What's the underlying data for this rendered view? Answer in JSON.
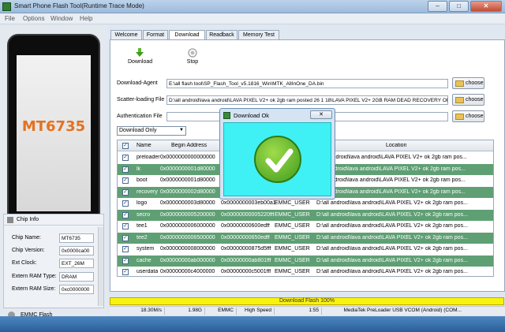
{
  "window": {
    "title": "Smart Phone Flash Tool(Runtime Trace Mode)",
    "buttons": {
      "minimize": "–",
      "maximize": "□",
      "close": "✕"
    }
  },
  "menu": [
    "File",
    "Options",
    "Window",
    "Help"
  ],
  "left_panel": {
    "chip_label": "MT6735",
    "chip_info_title": "Chip Info",
    "fields": [
      {
        "label": "Chip Name:",
        "value": "MT6735"
      },
      {
        "label": "Chip Version:",
        "value": "0x0000ca00"
      },
      {
        "label": "Ext Clock:",
        "value": "EXT_26M"
      },
      {
        "label": "Extern RAM Type:",
        "value": "DRAM"
      },
      {
        "label": "Extern RAM Size:",
        "value": "0xc0000000"
      }
    ],
    "storage": "EMMC Flash"
  },
  "tabs": [
    "Welcome",
    "Format",
    "Download",
    "Readback",
    "Memory Test"
  ],
  "active_tab": "Download",
  "toolbar": {
    "download": "Download",
    "stop": "Stop"
  },
  "files": {
    "download_agent_label": "Download-Agent",
    "download_agent_value": "E:\\all flash tool\\SP_Flash_Tool_v5.1816_Win\\MTK_AllInOne_DA.bin",
    "scatter_label": "Scatter-loading File",
    "scatter_value": "D:\\all android\\lava android\\LAVA PIXEL V2+ ok 2gb ram posted 26 1 18\\LAVA PIXEL V2+ 2GB RAM DEAD RECOVERY OK\\MT",
    "auth_label": "Authentication File",
    "auth_value": "",
    "choose": "choose"
  },
  "mode": "Download Only",
  "table": {
    "headers": [
      "Name",
      "Begin Address",
      "",
      "",
      "Location"
    ],
    "rows": [
      {
        "name": "preloader",
        "begin": "0x0000000000000000",
        "end": "",
        "region": "",
        "location": "...\\all android\\lava android\\LAVA PIXEL V2+ ok 2gb ram pos...",
        "selected": false
      },
      {
        "name": "lk",
        "begin": "0x0000000001d80000",
        "end": "",
        "region": "",
        "location": "...all android\\lava android\\LAVA PIXEL V2+ ok 2gb ram pos...",
        "selected": true
      },
      {
        "name": "boot",
        "begin": "0x0000000001d80000",
        "end": "",
        "region": "",
        "location": "...all android\\lava android\\LAVA PIXEL V2+ ok 2gb ram pos...",
        "selected": false
      },
      {
        "name": "recovery",
        "begin": "0x0000000002d80000",
        "end": "",
        "region": "",
        "location": "...all android\\lava android\\LAVA PIXEL V2+ ok 2gb ram pos...",
        "selected": true
      },
      {
        "name": "logo",
        "begin": "0x0000000003d80000",
        "end": "0x0000000003eb00a1",
        "region": "EMMC_USER",
        "location": "D:\\all android\\lava android\\LAVA PIXEL V2+ ok 2gb ram pos...",
        "selected": false
      },
      {
        "name": "secro",
        "begin": "0x0000000005200000",
        "end": "0x00000000005220fff",
        "region": "EMMC_USER",
        "location": "D:\\all android\\lava android\\LAVA PIXEL V2+ ok 2gb ram pos...",
        "selected": true
      },
      {
        "name": "tee1",
        "begin": "0x0000000006000000",
        "end": "0x00000000600edff",
        "region": "EMMC_USER",
        "location": "D:\\all android\\lava android\\LAVA PIXEL V2+ ok 2gb ram pos...",
        "selected": false
      },
      {
        "name": "tee2",
        "begin": "0x0000000006500000",
        "end": "0x00000000650edff",
        "region": "EMMC_USER",
        "location": "D:\\all android\\lava android\\LAVA PIXEL V2+ ok 2gb ram pos...",
        "selected": true
      },
      {
        "name": "system",
        "begin": "0x0000000008000000",
        "end": "0x00000000875d5fff",
        "region": "EMMC_USER",
        "location": "D:\\all android\\lava android\\LAVA PIXEL V2+ ok 2gb ram pos...",
        "selected": false
      },
      {
        "name": "cache",
        "begin": "0x00000000ab000000",
        "end": "0x00000000ab801fff",
        "region": "EMMC_USER",
        "location": "D:\\all android\\lava android\\LAVA PIXEL V2+ ok 2gb ram pos...",
        "selected": true
      },
      {
        "name": "userdata",
        "begin": "0x00000000c4000000",
        "end": "0x00000000c5001fff",
        "region": "EMMC_USER",
        "location": "D:\\all android\\lava android\\LAVA PIXEL V2+ ok 2gb ram pos...",
        "selected": false
      }
    ]
  },
  "dialog": {
    "title": "Download Ok",
    "close": "✕"
  },
  "progress": {
    "text": "Download Flash 100%",
    "fraction": 1.0,
    "color": "#f8f20f"
  },
  "status": {
    "speed": "18.30M/s",
    "size": "1.98G",
    "storage": "EMMC",
    "mode": "High Speed",
    "time": "1:55",
    "port": "MediaTek PreLoader USB VCOM (Android) (COM..."
  },
  "colors": {
    "selected_row": "#5f9f74",
    "dialog_body": "#3ff0f5",
    "accent": "#e4721e"
  }
}
